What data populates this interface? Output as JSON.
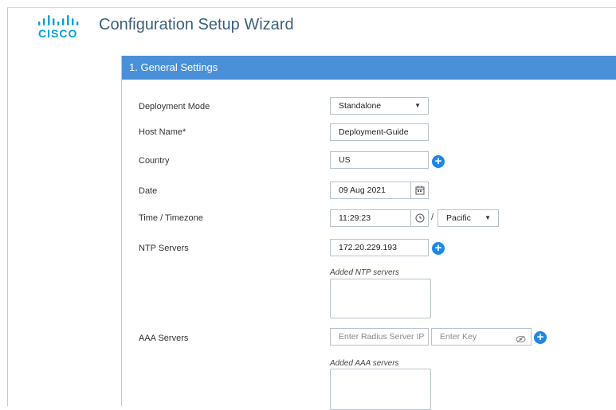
{
  "brand": {
    "logo_text": "CISCO",
    "color": "#049fd9"
  },
  "app": {
    "title": "Configuration Setup Wizard"
  },
  "panel": {
    "header": "1. General Settings",
    "header_color": "#4a90d9"
  },
  "form": {
    "deployment_mode": {
      "label": "Deployment Mode",
      "value": "Standalone"
    },
    "host_name": {
      "label": "Host Name*",
      "value": "Deployment-Guide"
    },
    "country": {
      "label": "Country",
      "value": "US"
    },
    "date": {
      "label": "Date",
      "value": "09 Aug 2021"
    },
    "time_timezone": {
      "label": "Time / Timezone",
      "time": "11:29:23",
      "separator": "/",
      "timezone": "Pacific"
    },
    "ntp_servers": {
      "label": "NTP Servers",
      "value": "172.20.229.193",
      "added_label": "Added NTP servers"
    },
    "aaa_servers": {
      "label": "AAA Servers",
      "ip_placeholder": "Enter Radius Server IP",
      "key_placeholder": "Enter Key",
      "added_label": "Added AAA servers"
    }
  },
  "icons": {
    "dropdown": "chevron-down-icon",
    "add": "plus-circle-icon",
    "calendar": "calendar-icon",
    "clock": "clock-icon",
    "visibility": "eye-slash-icon"
  }
}
